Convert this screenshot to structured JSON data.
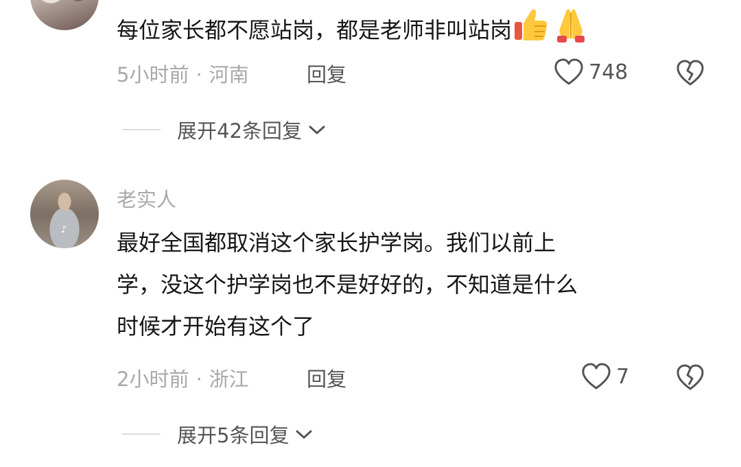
{
  "comments": [
    {
      "text": "每位家长都不愿站岗，都是老师非叫站岗",
      "emojis": [
        "thumbs-up-icon",
        "folded-hands-icon"
      ],
      "time": "5小时前",
      "location": "河南",
      "reply_label": "回复",
      "likes": "748",
      "expand_label": "展开42条回复"
    },
    {
      "username": "老实人",
      "text_lines": [
        "最好全国都取消这个家长护学岗。我们以前上",
        "学，没这个护学岗也不是好好的，不知道是什么",
        "时候才开始有这个了"
      ],
      "time": "2小时前",
      "location": "浙江",
      "reply_label": "回复",
      "likes": "7",
      "expand_label": "展开5条回复"
    }
  ],
  "meta_separator": "·",
  "colors": {
    "text": "#161616",
    "muted": "#a8a8a8",
    "action": "#555555"
  }
}
